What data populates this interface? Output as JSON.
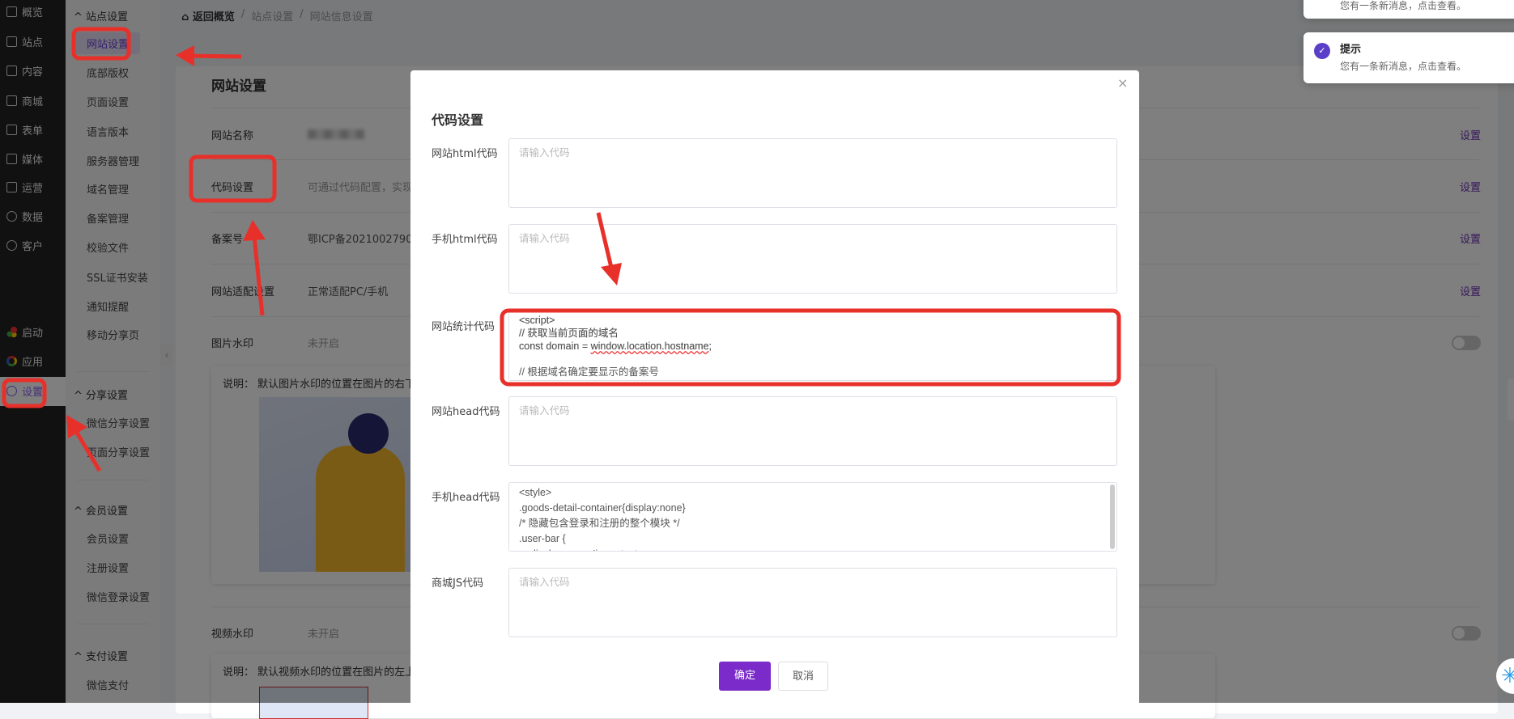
{
  "nav": {
    "items": [
      "概览",
      "站点",
      "内容",
      "商城",
      "表单",
      "媒体",
      "运营",
      "数据",
      "客户"
    ],
    "bottom": [
      "启动",
      "应用",
      "设置"
    ]
  },
  "sub": {
    "groups": [
      {
        "title": "站点设置",
        "items": [
          "网站设置",
          "底部版权",
          "页面设置",
          "语言版本",
          "服务器管理",
          "域名管理",
          "备案管理",
          "校验文件",
          "SSL证书安装",
          "通知提醒",
          "移动分享页"
        ]
      },
      {
        "title": "分享设置",
        "items": [
          "微信分享设置",
          "页面分享设置"
        ]
      },
      {
        "title": "会员设置",
        "items": [
          "会员设置",
          "注册设置",
          "微信登录设置"
        ]
      },
      {
        "title": "支付设置",
        "items": [
          "微信支付"
        ]
      }
    ]
  },
  "breadcrumb": {
    "home": "返回概览",
    "sep": "/",
    "c1": "站点设置",
    "c2": "网站信息设置"
  },
  "page": {
    "title": "网站设置",
    "rows": [
      {
        "label": "网站名称",
        "value": "",
        "link": "设置"
      },
      {
        "label": "代码设置",
        "value": "可通过代码配置，实现",
        "link": "设置"
      },
      {
        "label": "备案号",
        "value": "鄂ICP备2021002790号",
        "link": "设置"
      },
      {
        "label": "网站适配设置",
        "value": "正常适配PC/手机",
        "link": "设置"
      },
      {
        "label": "图片水印",
        "value": "未开启"
      },
      {
        "label": "视频水印",
        "value": "未开启"
      }
    ],
    "desc1": "说明：  默认图片水印的位置在图片的右下",
    "desc2": "说明：  默认视频水印的位置在图片的左上"
  },
  "notifications": [
    {
      "title": "提示",
      "text": "您有一条新消息，点击查看。"
    },
    {
      "title": "提示",
      "text": "您有一条新消息，点击查看。"
    }
  ],
  "modal": {
    "title": "代码设置",
    "close": "×",
    "fields": [
      {
        "label": "网站html代码",
        "placeholder": "请输入代码",
        "value": ""
      },
      {
        "label": "手机html代码",
        "placeholder": "请输入代码",
        "value": ""
      },
      {
        "label": "网站统计代码",
        "placeholder": "请输入代码",
        "value": "<script>\n// 获取当前页面的域名\nconst domain = window.location.hostname;\n\n// 根据域名确定要显示的备案号"
      },
      {
        "label": "网站head代码",
        "placeholder": "请输入代码",
        "value": ""
      },
      {
        "label": "手机head代码",
        "placeholder": "请输入代码",
        "value": "<style>\n.goods-detail-container{display:none}\n/* 隐藏包含登录和注册的整个模块 */\n.user-bar {\n    display: none !important;"
      },
      {
        "label": "商城JS代码",
        "placeholder": "请输入代码",
        "value": ""
      }
    ],
    "ok": "确定",
    "cancel": "取消",
    "stat_l1": "<script>",
    "stat_l2": "// 获取当前页面的域名",
    "stat_l3a": "const domain = ",
    "stat_l3b": "window.location.hostname",
    "stat_l3c": ";"
  },
  "colors": {
    "accent": "#7b2bc9",
    "annotation": "#e8302b"
  }
}
